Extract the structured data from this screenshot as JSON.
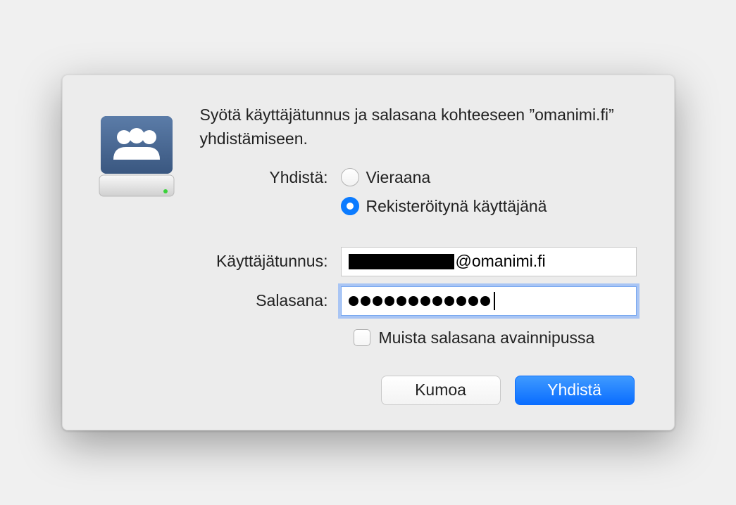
{
  "dialog": {
    "title": "Syötä käyttäjätunnus ja salasana kohteeseen ”omanimi.fi” yhdistämiseen.",
    "connect_as_label": "Yhdistä:",
    "guest_label": "Vieraana",
    "registered_label": "Rekisteröitynä käyttäjänä",
    "selected_option": "registered",
    "username_label": "Käyttäjätunnus:",
    "username_suffix": "@omanimi.fi",
    "password_label": "Salasana:",
    "password_length": 12,
    "remember_label": "Muista salasana avainnipussa",
    "remember_checked": false,
    "cancel_label": "Kumoa",
    "connect_label": "Yhdistä"
  }
}
